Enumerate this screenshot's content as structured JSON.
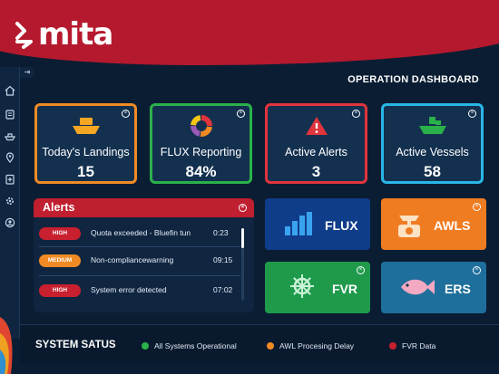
{
  "brand": {
    "name": "mita"
  },
  "page_title": "OPERATION DASHBOARD",
  "sidebar": {
    "collapse_glyph": "⇥",
    "icons": [
      "home-icon",
      "clipboard-icon",
      "ship-icon",
      "location-pin-icon",
      "document-plus-icon",
      "gear-icon",
      "users-icon"
    ]
  },
  "stats": [
    {
      "label": "Today's Landings",
      "value": "15",
      "icon": "boat-icon",
      "border": "#f08a24"
    },
    {
      "label": "FLUX Reporting",
      "value": "84%",
      "icon": "donut-chart-icon",
      "border": "#2bb14a"
    },
    {
      "label": "Active Alerts",
      "value": "3",
      "icon": "warning-icon",
      "border": "#e1343c"
    },
    {
      "label": "Active Vessels",
      "value": "58",
      "icon": "vessel-icon",
      "border": "#29b6e8"
    }
  ],
  "alerts": {
    "title": "Alerts",
    "items": [
      {
        "level": "HIGH",
        "message": "Quota exceeded - Bluefin tun",
        "time": "0:23",
        "color": "#c8202f"
      },
      {
        "level": "MEDIUM",
        "message": "Non-compliancewarning",
        "time": "09:15",
        "color": "#f08a24"
      },
      {
        "level": "HIGH",
        "message": "System error detected",
        "time": "07:02",
        "color": "#c8202f"
      }
    ]
  },
  "modules": [
    {
      "label": "FLUX",
      "icon": "bar-chart-icon",
      "color": "#0f3d8a"
    },
    {
      "label": "AWLS",
      "icon": "scale-icon",
      "color": "#f07c22"
    },
    {
      "label": "FVR",
      "icon": "ship-wheel-icon",
      "color": "#1f9a4b"
    },
    {
      "label": "ERS",
      "icon": "fish-icon",
      "color": "#1f6f9c"
    }
  ],
  "system_status": {
    "title": "SYSTEM SATUS",
    "items": [
      {
        "label": "All Systems Operational",
        "color": "#2bb14a"
      },
      {
        "label": "AWL Procesing Delay",
        "color": "#f08a24"
      },
      {
        "label": "FVR Data",
        "color": "#c8202f"
      }
    ]
  },
  "colors": {
    "brand_red": "#b5192e",
    "background": "#0b1d33",
    "card": "#13304f"
  }
}
